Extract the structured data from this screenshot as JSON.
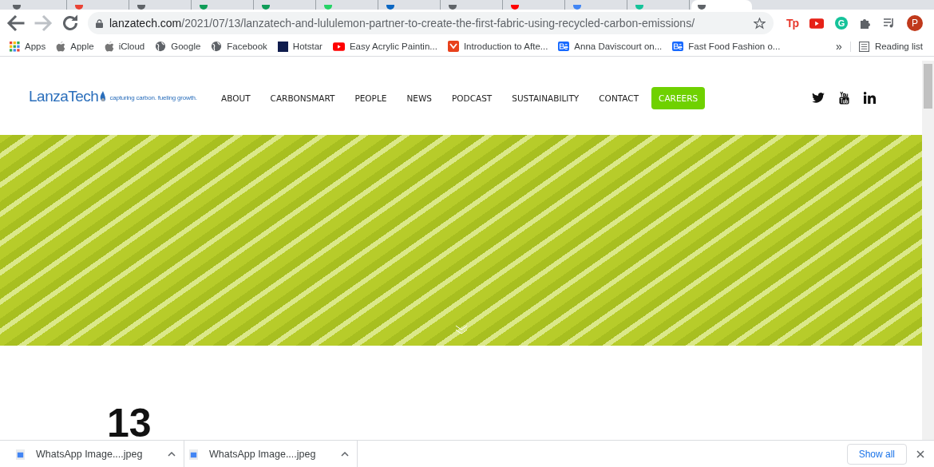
{
  "browser": {
    "tabs": [
      {
        "selected": false,
        "color": "#5f6368"
      },
      {
        "selected": false,
        "color": "#ea4335"
      },
      {
        "selected": false,
        "color": "#5f6368"
      },
      {
        "selected": false,
        "color": "#0f9d58"
      },
      {
        "selected": false,
        "color": "#0f9d58"
      },
      {
        "selected": false,
        "color": "#25d366"
      },
      {
        "selected": false,
        "color": "#0a66c2"
      },
      {
        "selected": false,
        "color": "#5f6368"
      },
      {
        "selected": false,
        "color": "#ff0000"
      },
      {
        "selected": false,
        "color": "#4285f4"
      },
      {
        "selected": false,
        "color": "#15c39a"
      },
      {
        "selected": true,
        "color": "#5f6368"
      }
    ],
    "address": {
      "domain": "lanzatech.com",
      "path": "/2021/07/13/lanzatech-and-lululemon-partner-to-create-the-first-fabric-using-recycled-carbon-emissions/"
    },
    "extensions": [
      {
        "kind": "tp",
        "label": "Tp"
      },
      {
        "kind": "youtube"
      },
      {
        "kind": "grammarly",
        "label": "G"
      },
      {
        "kind": "puzzle"
      },
      {
        "kind": "media"
      },
      {
        "kind": "profile",
        "label": "P"
      }
    ],
    "bookmarks": [
      {
        "kind": "apps",
        "label": "Apps"
      },
      {
        "kind": "apple",
        "label": "Apple"
      },
      {
        "kind": "apple",
        "label": "iCloud"
      },
      {
        "kind": "globe",
        "label": "Google"
      },
      {
        "kind": "globe",
        "label": "Facebook"
      },
      {
        "kind": "hotstar",
        "label": "Hotstar"
      },
      {
        "kind": "youtube",
        "label": "Easy Acrylic Paintin..."
      },
      {
        "kind": "red",
        "label": "Introduction to Afte..."
      },
      {
        "kind": "behance",
        "label": "Anna Daviscourt on..."
      },
      {
        "kind": "behance",
        "label": "Fast Food Fashion o..."
      }
    ],
    "overflow": "»",
    "reading_list": "Reading list"
  },
  "site": {
    "logo": {
      "name": "LanzaTech",
      "tagline": "capturing carbon. fueling growth."
    },
    "nav": [
      {
        "label": "ABOUT",
        "highlighted": false
      },
      {
        "label": "CARBONSMART",
        "highlighted": false
      },
      {
        "label": "PEOPLE",
        "highlighted": false
      },
      {
        "label": "NEWS",
        "highlighted": false
      },
      {
        "label": "PODCAST",
        "highlighted": false
      },
      {
        "label": "SUSTAINABILITY",
        "highlighted": false
      },
      {
        "label": "CONTACT",
        "highlighted": false
      },
      {
        "label": "CAREERS",
        "highlighted": true
      }
    ],
    "social": [
      {
        "kind": "twitter"
      },
      {
        "kind": "youtube"
      },
      {
        "kind": "linkedin"
      }
    ],
    "date_day": "13"
  },
  "downloads": {
    "items": [
      {
        "name": "WhatsApp Image....jpeg"
      },
      {
        "name": "WhatsApp Image....jpeg"
      }
    ],
    "show_all": "Show all"
  }
}
